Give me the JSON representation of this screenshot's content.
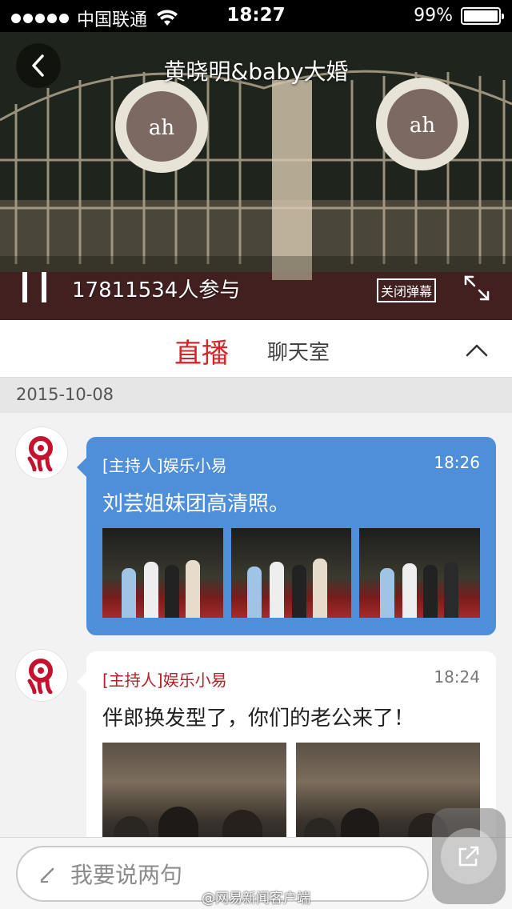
{
  "status_bar": {
    "carrier": "中国联通",
    "time": "18:27",
    "battery": "99%",
    "battery_level": 0.99
  },
  "video": {
    "title": "黄晓明&baby大婚",
    "participants": "17811534人参与",
    "danmu_toggle": "关闭弹幕"
  },
  "tabs": {
    "live": "直播",
    "chat": "聊天室"
  },
  "date": "2015-10-08",
  "messages": [
    {
      "author": "[主持人]娱乐小易",
      "time": "18:26",
      "text": "刘芸姐妹团高清照。",
      "style": "blue",
      "photo_count": 3
    },
    {
      "author": "[主持人]娱乐小易",
      "time": "18:24",
      "text": "伴郎换发型了，你们的老公来了！",
      "style": "white",
      "photo_count": 2
    }
  ],
  "input": {
    "placeholder": "我要说两句"
  },
  "watermark": "@网易新闻客户端",
  "colors": {
    "accent_red": "#d7242a",
    "bubble_blue": "#4f8fd9"
  }
}
